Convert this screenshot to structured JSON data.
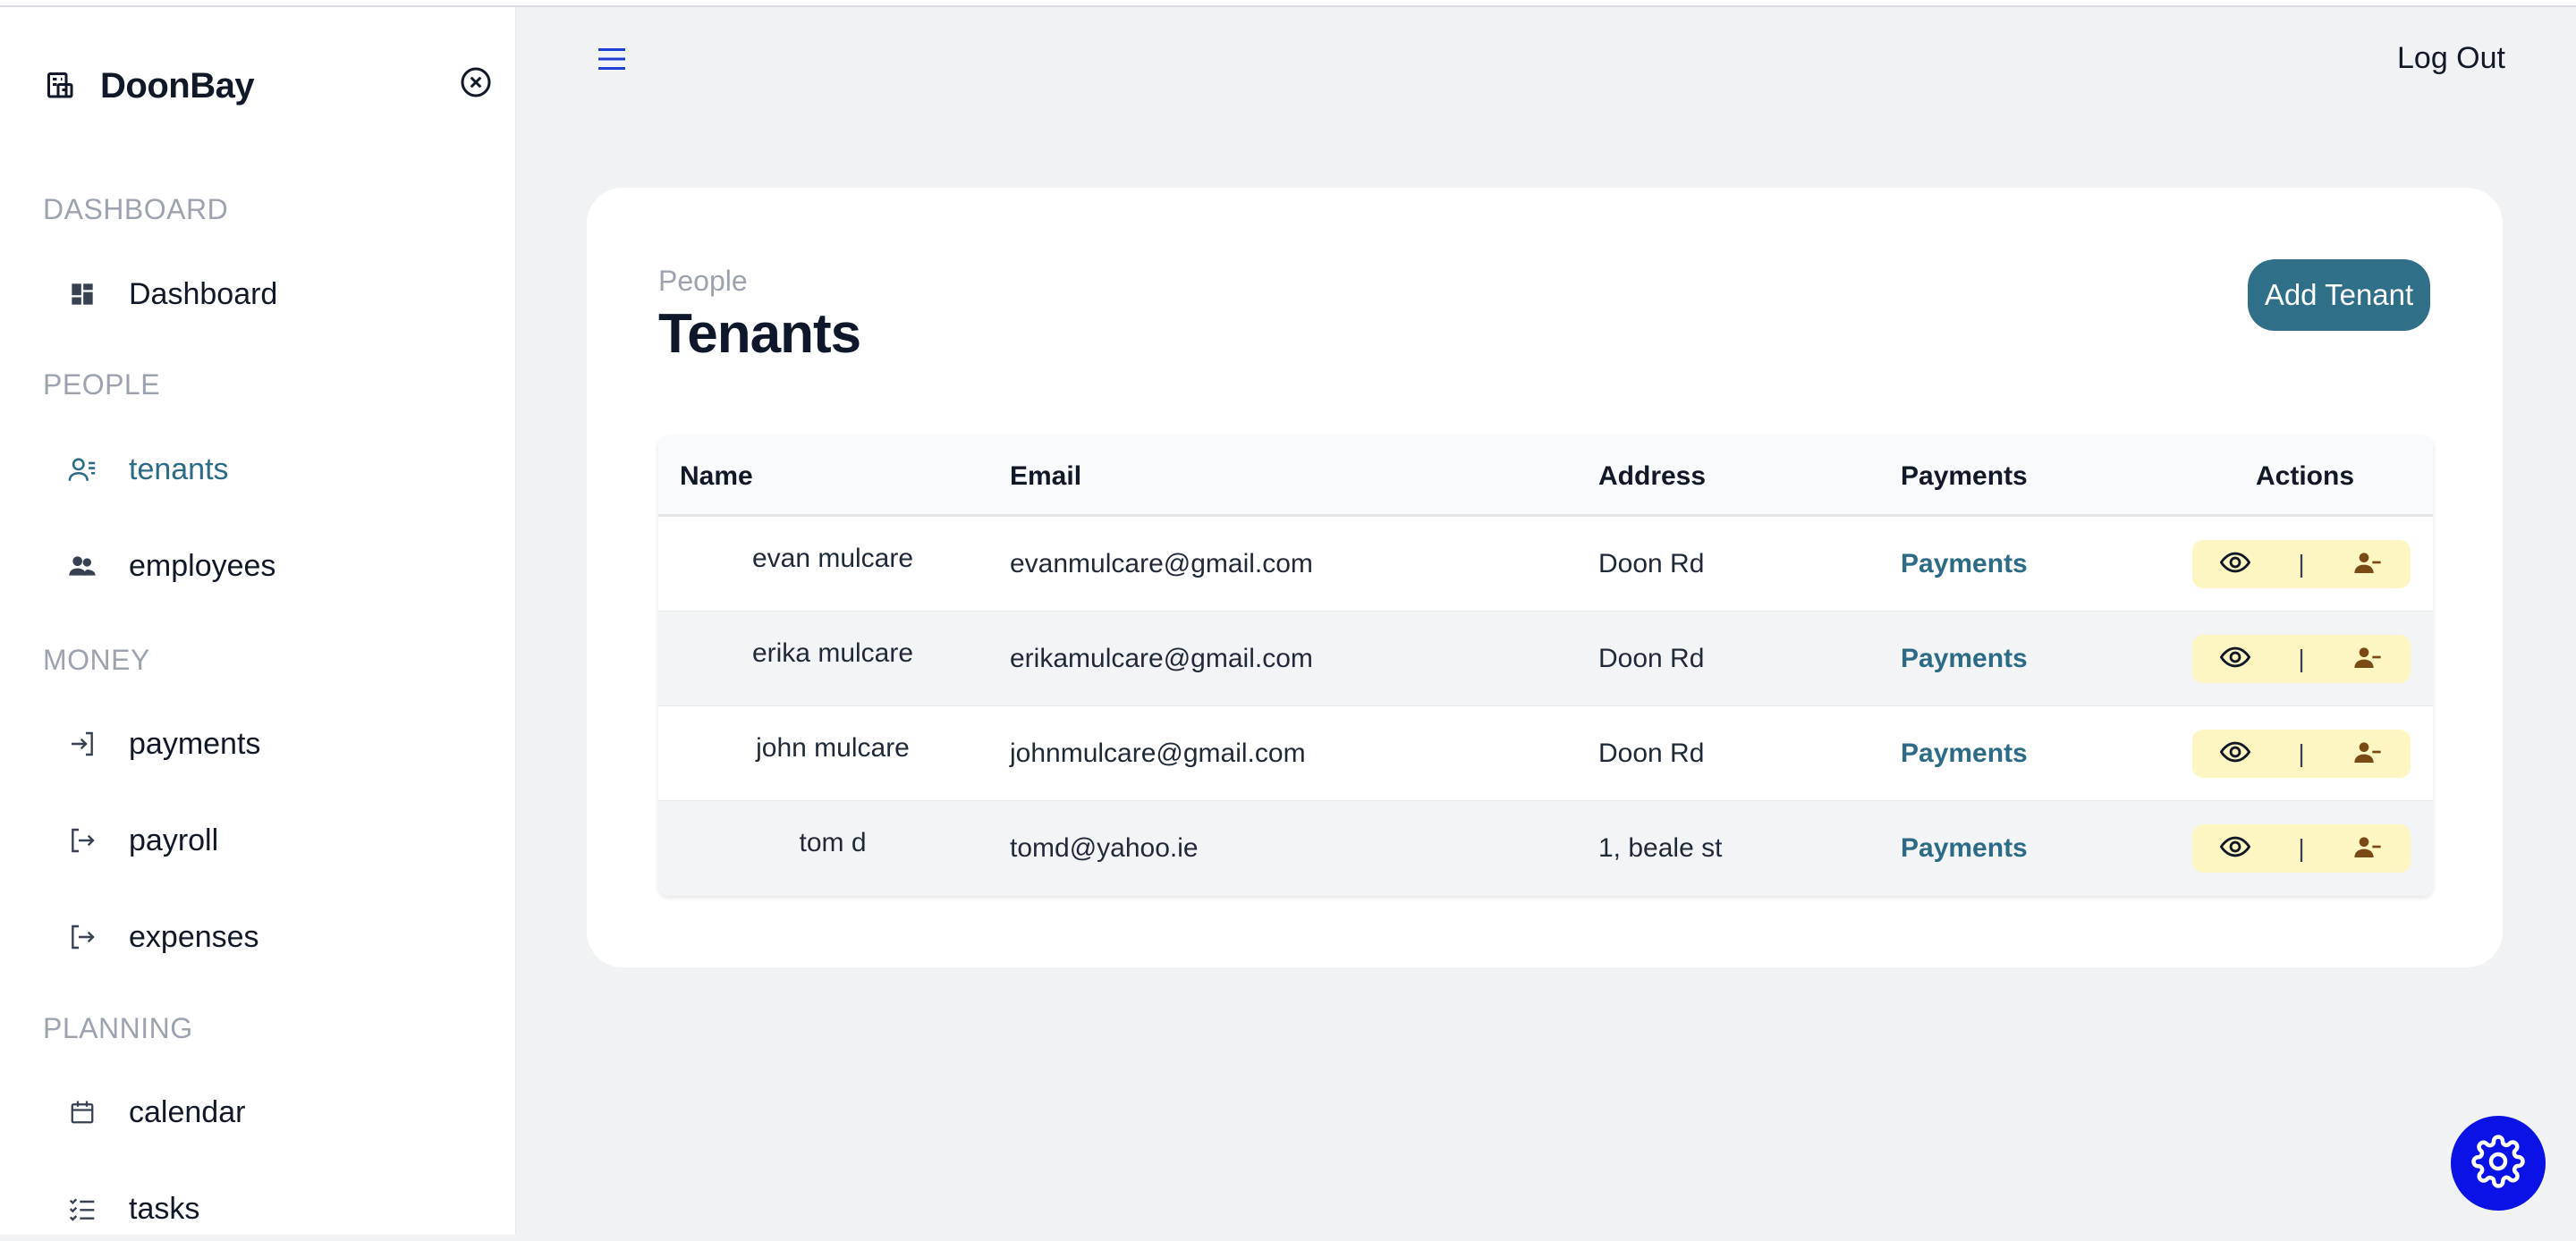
{
  "app": {
    "name": "DoonBay"
  },
  "sidebar": {
    "sections": [
      {
        "title": "DASHBOARD"
      },
      {
        "title": "PEOPLE"
      },
      {
        "title": "MONEY"
      },
      {
        "title": "PLANNING"
      }
    ],
    "items": [
      {
        "label": "Dashboard",
        "icon": "dashboard-icon"
      },
      {
        "label": "tenants",
        "icon": "tenants-icon",
        "active": true
      },
      {
        "label": "employees",
        "icon": "employees-icon"
      },
      {
        "label": "payments",
        "icon": "login-arrow-icon"
      },
      {
        "label": "payroll",
        "icon": "logout-arrow-icon"
      },
      {
        "label": "expenses",
        "icon": "logout-arrow-icon"
      },
      {
        "label": "calendar",
        "icon": "calendar-icon"
      },
      {
        "label": "tasks",
        "icon": "tasks-icon"
      }
    ]
  },
  "header": {
    "logout_label": "Log Out"
  },
  "page": {
    "breadcrumb": "People",
    "title": "Tenants",
    "add_button_label": "Add Tenant"
  },
  "table": {
    "columns": [
      "Name",
      "Email",
      "Address",
      "Payments",
      "Actions"
    ],
    "rows": [
      {
        "name": "evan mulcare",
        "email": "evanmulcare@gmail.com",
        "address": "Doon Rd",
        "payments": "Payments"
      },
      {
        "name": "erika mulcare",
        "email": "erikamulcare@gmail.com",
        "address": "Doon Rd",
        "payments": "Payments"
      },
      {
        "name": "john mulcare",
        "email": "johnmulcare@gmail.com",
        "address": "Doon Rd",
        "payments": "Payments"
      },
      {
        "name": "tom d",
        "email": "tomd@yahoo.ie",
        "address": "1, beale st",
        "payments": "Payments"
      }
    ],
    "action_separator": "|"
  },
  "colors": {
    "accent": "#2f6f88",
    "link": "#2c6b85",
    "actions_bg": "#fdf6c3",
    "fab": "#0a12e6",
    "hamburger": "#1d3fd6"
  }
}
